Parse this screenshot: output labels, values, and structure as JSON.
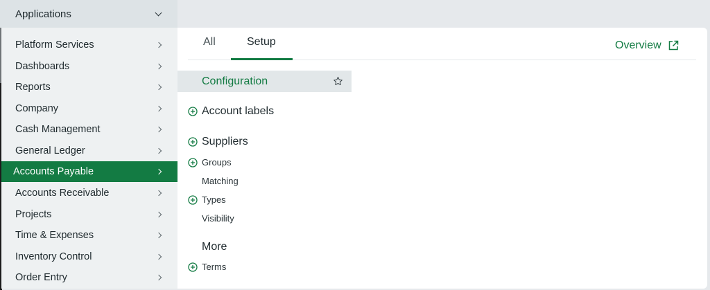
{
  "header": {
    "applications_label": "Applications"
  },
  "sidebar": {
    "items": [
      {
        "label": "Platform Services",
        "active": false
      },
      {
        "label": "Dashboards",
        "active": false
      },
      {
        "label": "Reports",
        "active": false
      },
      {
        "label": "Company",
        "active": false
      },
      {
        "label": "Cash Management",
        "active": false
      },
      {
        "label": "General Ledger",
        "active": false
      },
      {
        "label": "Accounts Payable",
        "active": true
      },
      {
        "label": "Accounts Receivable",
        "active": false
      },
      {
        "label": "Projects",
        "active": false
      },
      {
        "label": "Time & Expenses",
        "active": false
      },
      {
        "label": "Inventory Control",
        "active": false
      },
      {
        "label": "Order Entry",
        "active": false
      }
    ]
  },
  "tabs": {
    "all_label": "All",
    "setup_label": "Setup",
    "selected": "Setup"
  },
  "overview": {
    "label": "Overview",
    "icon": "external-link-icon"
  },
  "content": {
    "configuration_label": "Configuration",
    "account_labels": "Account labels",
    "suppliers": "Suppliers",
    "groups": "Groups",
    "matching": "Matching",
    "types": "Types",
    "visibility": "Visibility",
    "more": "More",
    "terms": "Terms"
  },
  "colors": {
    "accent": "#137b43",
    "sidebar_bg": "#eef1f2",
    "page_bg": "#e6e9ec"
  }
}
